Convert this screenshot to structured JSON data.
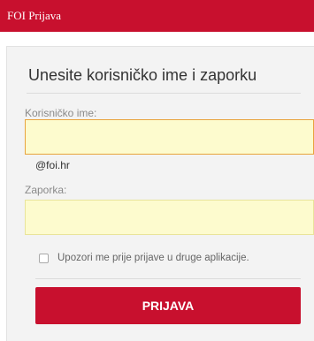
{
  "window": {
    "title": "FOI Prijava"
  },
  "form": {
    "heading": "Unesite korisničko ime i zaporku",
    "username_label": "Korisničko ime:",
    "username_value": "",
    "domain_hint": "@foi.hr",
    "password_label": "Zaporka:",
    "password_value": "",
    "warn_checkbox_label": "Upozori me prije prijave u druge aplikacije.",
    "warn_checkbox_checked": false,
    "submit_label": "PRIJAVA"
  },
  "colors": {
    "accent": "#c8102e",
    "field_background": "#fdfbce",
    "panel_background": "#f3f3f3"
  }
}
